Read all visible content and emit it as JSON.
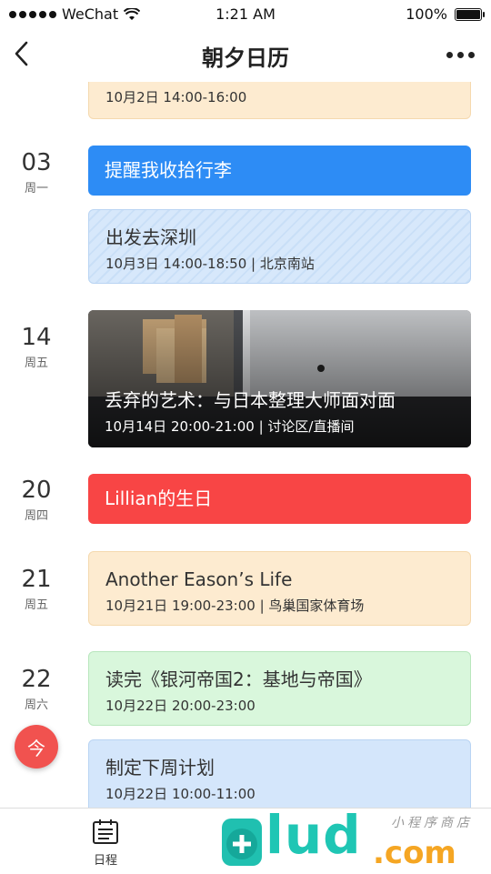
{
  "status_bar": {
    "carrier": "WeChat",
    "time": "1:21 AM",
    "battery": "100%"
  },
  "nav": {
    "title": "朝夕日历"
  },
  "events": [
    {
      "meta": "10月2日 14:00-16:00",
      "color": "#fdebd0"
    },
    {
      "title": "提醒我收拾行李",
      "color": "#2d8cf5"
    },
    {
      "title": "出发去深圳",
      "meta": "10月3日 14:00-18:50 | 北京南站",
      "color": "#d7e8fb"
    },
    {
      "title": "丢弃的艺术：与日本整理大师面对面",
      "meta": "10月14日 20:00-21:00 | 讨论区/直播间"
    },
    {
      "title": "Lillian的生日",
      "color": "#f84545"
    },
    {
      "title": "Another Eason’s Life",
      "meta": "10月21日 19:00-23:00 | 鸟巢国家体育场",
      "color": "#fdebd0"
    },
    {
      "title": "读完《银河帝国2：基地与帝国》",
      "meta": "10月22日 20:00-23:00",
      "color": "#d9f7dc"
    },
    {
      "title": "制定下周计划",
      "meta": "10月22日 10:00-11:00",
      "color": "#d4e6fb"
    }
  ],
  "dates": [
    {
      "day": "03",
      "weekday": "周一"
    },
    {
      "day": "14",
      "weekday": "周五"
    },
    {
      "day": "20",
      "weekday": "周四"
    },
    {
      "day": "21",
      "weekday": "周五"
    },
    {
      "day": "22",
      "weekday": "周六"
    }
  ],
  "fab": {
    "label": "今"
  },
  "tabbar": {
    "schedule_label": "日程"
  },
  "watermark": {
    "text": "lud",
    "suffix": ".com",
    "script": "小程序商店"
  }
}
